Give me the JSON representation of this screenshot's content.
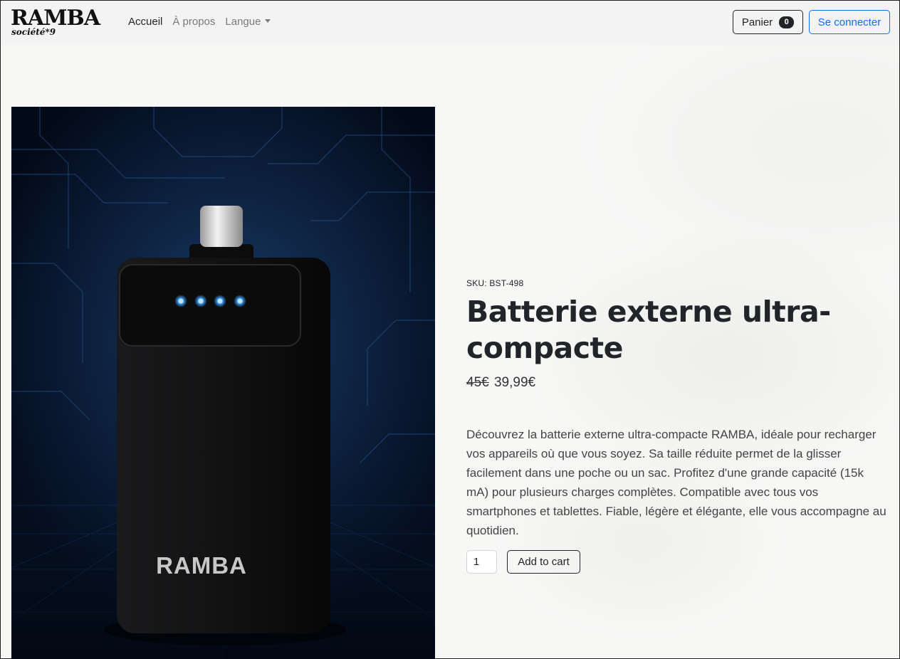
{
  "brand": {
    "name": "RAMBA",
    "sub": "société*9"
  },
  "nav": {
    "home": "Accueil",
    "about": "À propos",
    "language": "Langue"
  },
  "cart": {
    "label": "Panier",
    "count": "0"
  },
  "login": {
    "label": "Se connecter"
  },
  "product": {
    "sku": "SKU: BST-498",
    "title": "Batterie externe ultra-compacte",
    "old_price": "45€",
    "price": "39,99€",
    "description": "Découvrez la batterie externe ultra-compacte RAMBA, idéale pour recharger vos appareils où que vous soyez. Sa taille réduite permet de la glisser facilement dans une poche ou un sac. Profitez d'une grande capacité (15k mA) pour plusieurs charges complètes. Compatible avec tous vos smartphones et tablettes. Fiable, légère et élégante, elle vous accompagne au quotidien.",
    "quantity": "1",
    "add_to_cart": "Add to cart",
    "image_brand": "RAMBA"
  },
  "colors": {
    "primary": "#0d6efd",
    "dark": "#212529",
    "led": "#3aa0ff"
  }
}
